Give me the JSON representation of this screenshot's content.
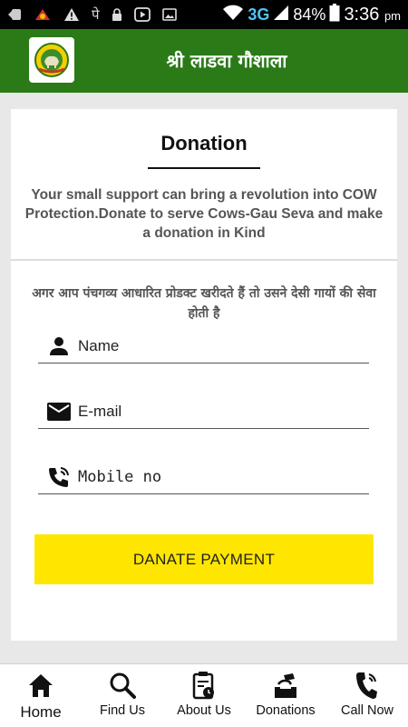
{
  "status_bar": {
    "network": "3G",
    "battery": "84%",
    "time": "3:36",
    "ampm": "pm"
  },
  "app_bar": {
    "title": "श्री लाडवा गौशाला"
  },
  "donation": {
    "title": "Donation",
    "description": "Your small support can bring a revolution into COW Protection.Donate to serve Cows-Gau Seva and make a donation in Kind",
    "hindi_note": "अगर आप पंचगव्य आधारित प्रोडक्ट खरीदते हैं तो उसने देसी गायों की सेवा होती है",
    "name_placeholder": "Name",
    "email_placeholder": "E-mail",
    "mobile_placeholder": "Mobile no",
    "pay_button": "DANATE PAYMENT"
  },
  "bottom_nav": {
    "items": [
      {
        "label": "Home",
        "icon": "home-icon"
      },
      {
        "label": "Find Us",
        "icon": "search-icon"
      },
      {
        "label": "About Us",
        "icon": "clipboard-clock-icon"
      },
      {
        "label": "Donations",
        "icon": "donation-box-icon"
      },
      {
        "label": "Call Now",
        "icon": "phone-icon"
      }
    ]
  },
  "colors": {
    "app_bar": "#2a7a17",
    "button": "#ffe600",
    "network": "#4fc3f7"
  }
}
